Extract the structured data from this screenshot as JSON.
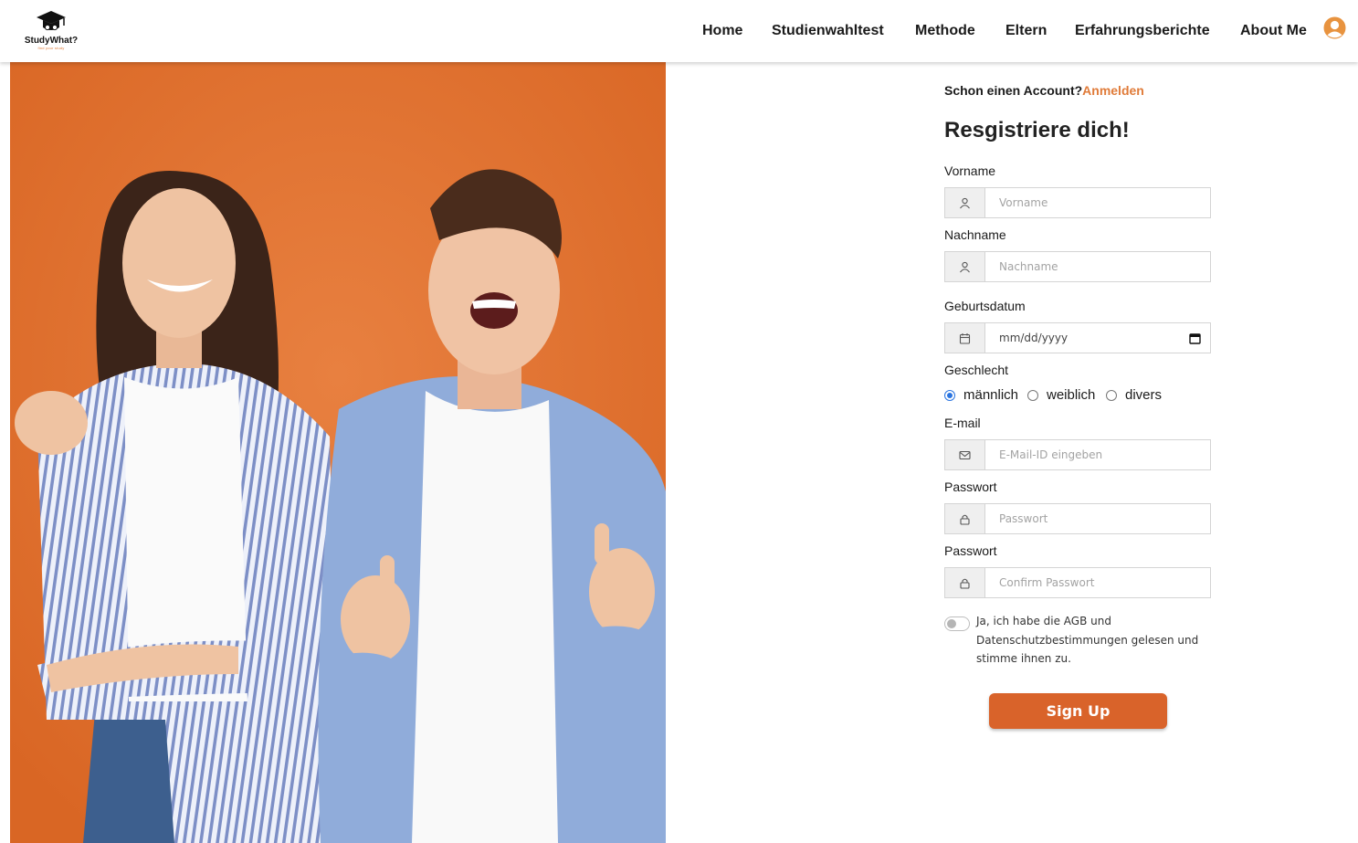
{
  "header": {
    "logo_name": "StudyWhat?",
    "logo_tagline": "find your study",
    "nav": [
      {
        "label": "Home"
      },
      {
        "label": "Studienwahltest"
      },
      {
        "label": "Methode"
      },
      {
        "label": "Eltern"
      },
      {
        "label": "Erfahrungsberichte"
      },
      {
        "label": "About Me"
      }
    ],
    "accent_color": "#e07b39"
  },
  "form": {
    "have_account_text": "Schon einen Account?",
    "login_link": "Anmelden",
    "title": "Resgistriere dich!",
    "fields": {
      "firstname": {
        "label": "Vorname",
        "placeholder": "Vorname",
        "icon": "user-icon"
      },
      "lastname": {
        "label": "Nachname",
        "placeholder": "Nachname",
        "icon": "user-icon"
      },
      "birthdate": {
        "label": "Geburtsdatum",
        "value": "mm/dd/yyyy",
        "icon": "calendar-icon"
      },
      "gender": {
        "label": "Geschlecht",
        "options": [
          "männlich",
          "weiblich",
          "divers"
        ],
        "selected": "männlich"
      },
      "email": {
        "label": "E-mail",
        "placeholder": "E-Mail-ID eingeben",
        "icon": "mail-icon"
      },
      "password": {
        "label": "Passwort",
        "placeholder": "Passwort",
        "icon": "lock-icon"
      },
      "confirm_password": {
        "label": "Passwort",
        "placeholder": "Confirm Passwort",
        "icon": "lock-icon"
      }
    },
    "terms_text": "Ja, ich habe die AGB und Datenschutzbestimmungen gelesen und stimme ihnen zu.",
    "terms_accepted": false,
    "submit_label": "Sign Up",
    "button_color": "#d9632a"
  }
}
